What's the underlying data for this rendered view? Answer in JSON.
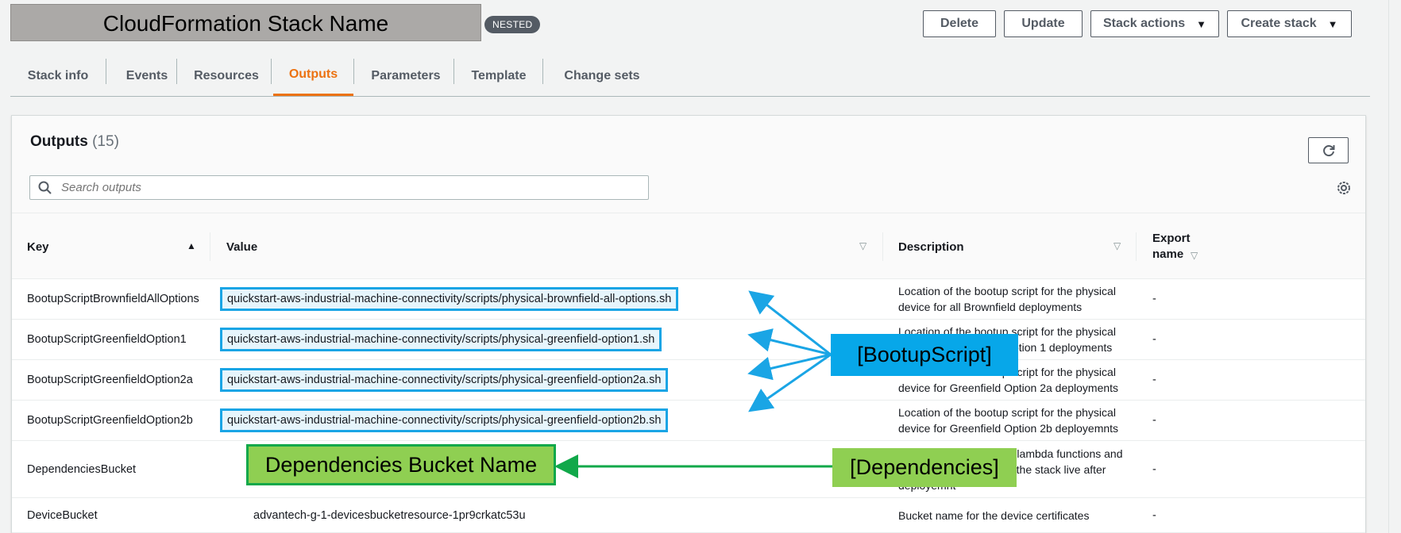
{
  "header": {
    "stack_name": "CloudFormation Stack Name",
    "badge": "NESTED",
    "buttons": {
      "delete": "Delete",
      "update": "Update",
      "stack_actions": "Stack actions",
      "create_stack": "Create stack"
    }
  },
  "tabs": [
    {
      "label": "Stack info"
    },
    {
      "label": "Events"
    },
    {
      "label": "Resources"
    },
    {
      "label": "Outputs",
      "active": true
    },
    {
      "label": "Parameters"
    },
    {
      "label": "Template"
    },
    {
      "label": "Change sets"
    }
  ],
  "outputs": {
    "title": "Outputs",
    "count": "(15)",
    "search_placeholder": "Search outputs",
    "columns": {
      "key": "Key",
      "value": "Value",
      "description": "Description",
      "export_line1": "Export",
      "export_line2": "name"
    },
    "rows": [
      {
        "key": "BootupScriptBrownfieldAllOptions",
        "value": "quickstart-aws-industrial-machine-connectivity/scripts/physical-brownfield-all-options.sh",
        "desc1": "Location of the bootup script for the physical",
        "desc2": "device for all Brownfield deployments",
        "export": "-"
      },
      {
        "key": "BootupScriptGreenfieldOption1",
        "value": "quickstart-aws-industrial-machine-connectivity/scripts/physical-greenfield-option1.sh",
        "desc1": "Location of the bootup script for the physical",
        "desc2": "device for Greenfield Option 1 deployments",
        "export": "-"
      },
      {
        "key": "BootupScriptGreenfieldOption2a",
        "value": "quickstart-aws-industrial-machine-connectivity/scripts/physical-greenfield-option2a.sh",
        "desc1": "Location of the bootup script for the physical",
        "desc2": "device for Greenfield Option 2a deployments",
        "export": "-"
      },
      {
        "key": "BootupScriptGreenfieldOption2b",
        "value": "quickstart-aws-industrial-machine-connectivity/scripts/physical-greenfield-option2b.sh",
        "desc1": "Location of the bootup script for the physical",
        "desc2": "device for Greenfield Option 2b deployemnts",
        "export": "-"
      },
      {
        "key": "DependenciesBucket",
        "value": "",
        "desc1": "S3 bucket where all the lambda functions and",
        "desc2": "script dependencies for the stack live after",
        "desc3": "deployemnt",
        "export": "-"
      },
      {
        "key": "DeviceBucket",
        "value": "advantech-g-1-devicesbucketresource-1pr9crkatc53u",
        "desc1": "Bucket name for the device certificates",
        "export": "-"
      }
    ]
  },
  "annotations": {
    "bootup_label": "[BootupScript]",
    "dependencies_label": "[Dependencies]",
    "dependencies_value": "Dependencies Bucket Name",
    "bootup_color": "#07a7e9",
    "dependencies_color": "#8fcf52"
  }
}
